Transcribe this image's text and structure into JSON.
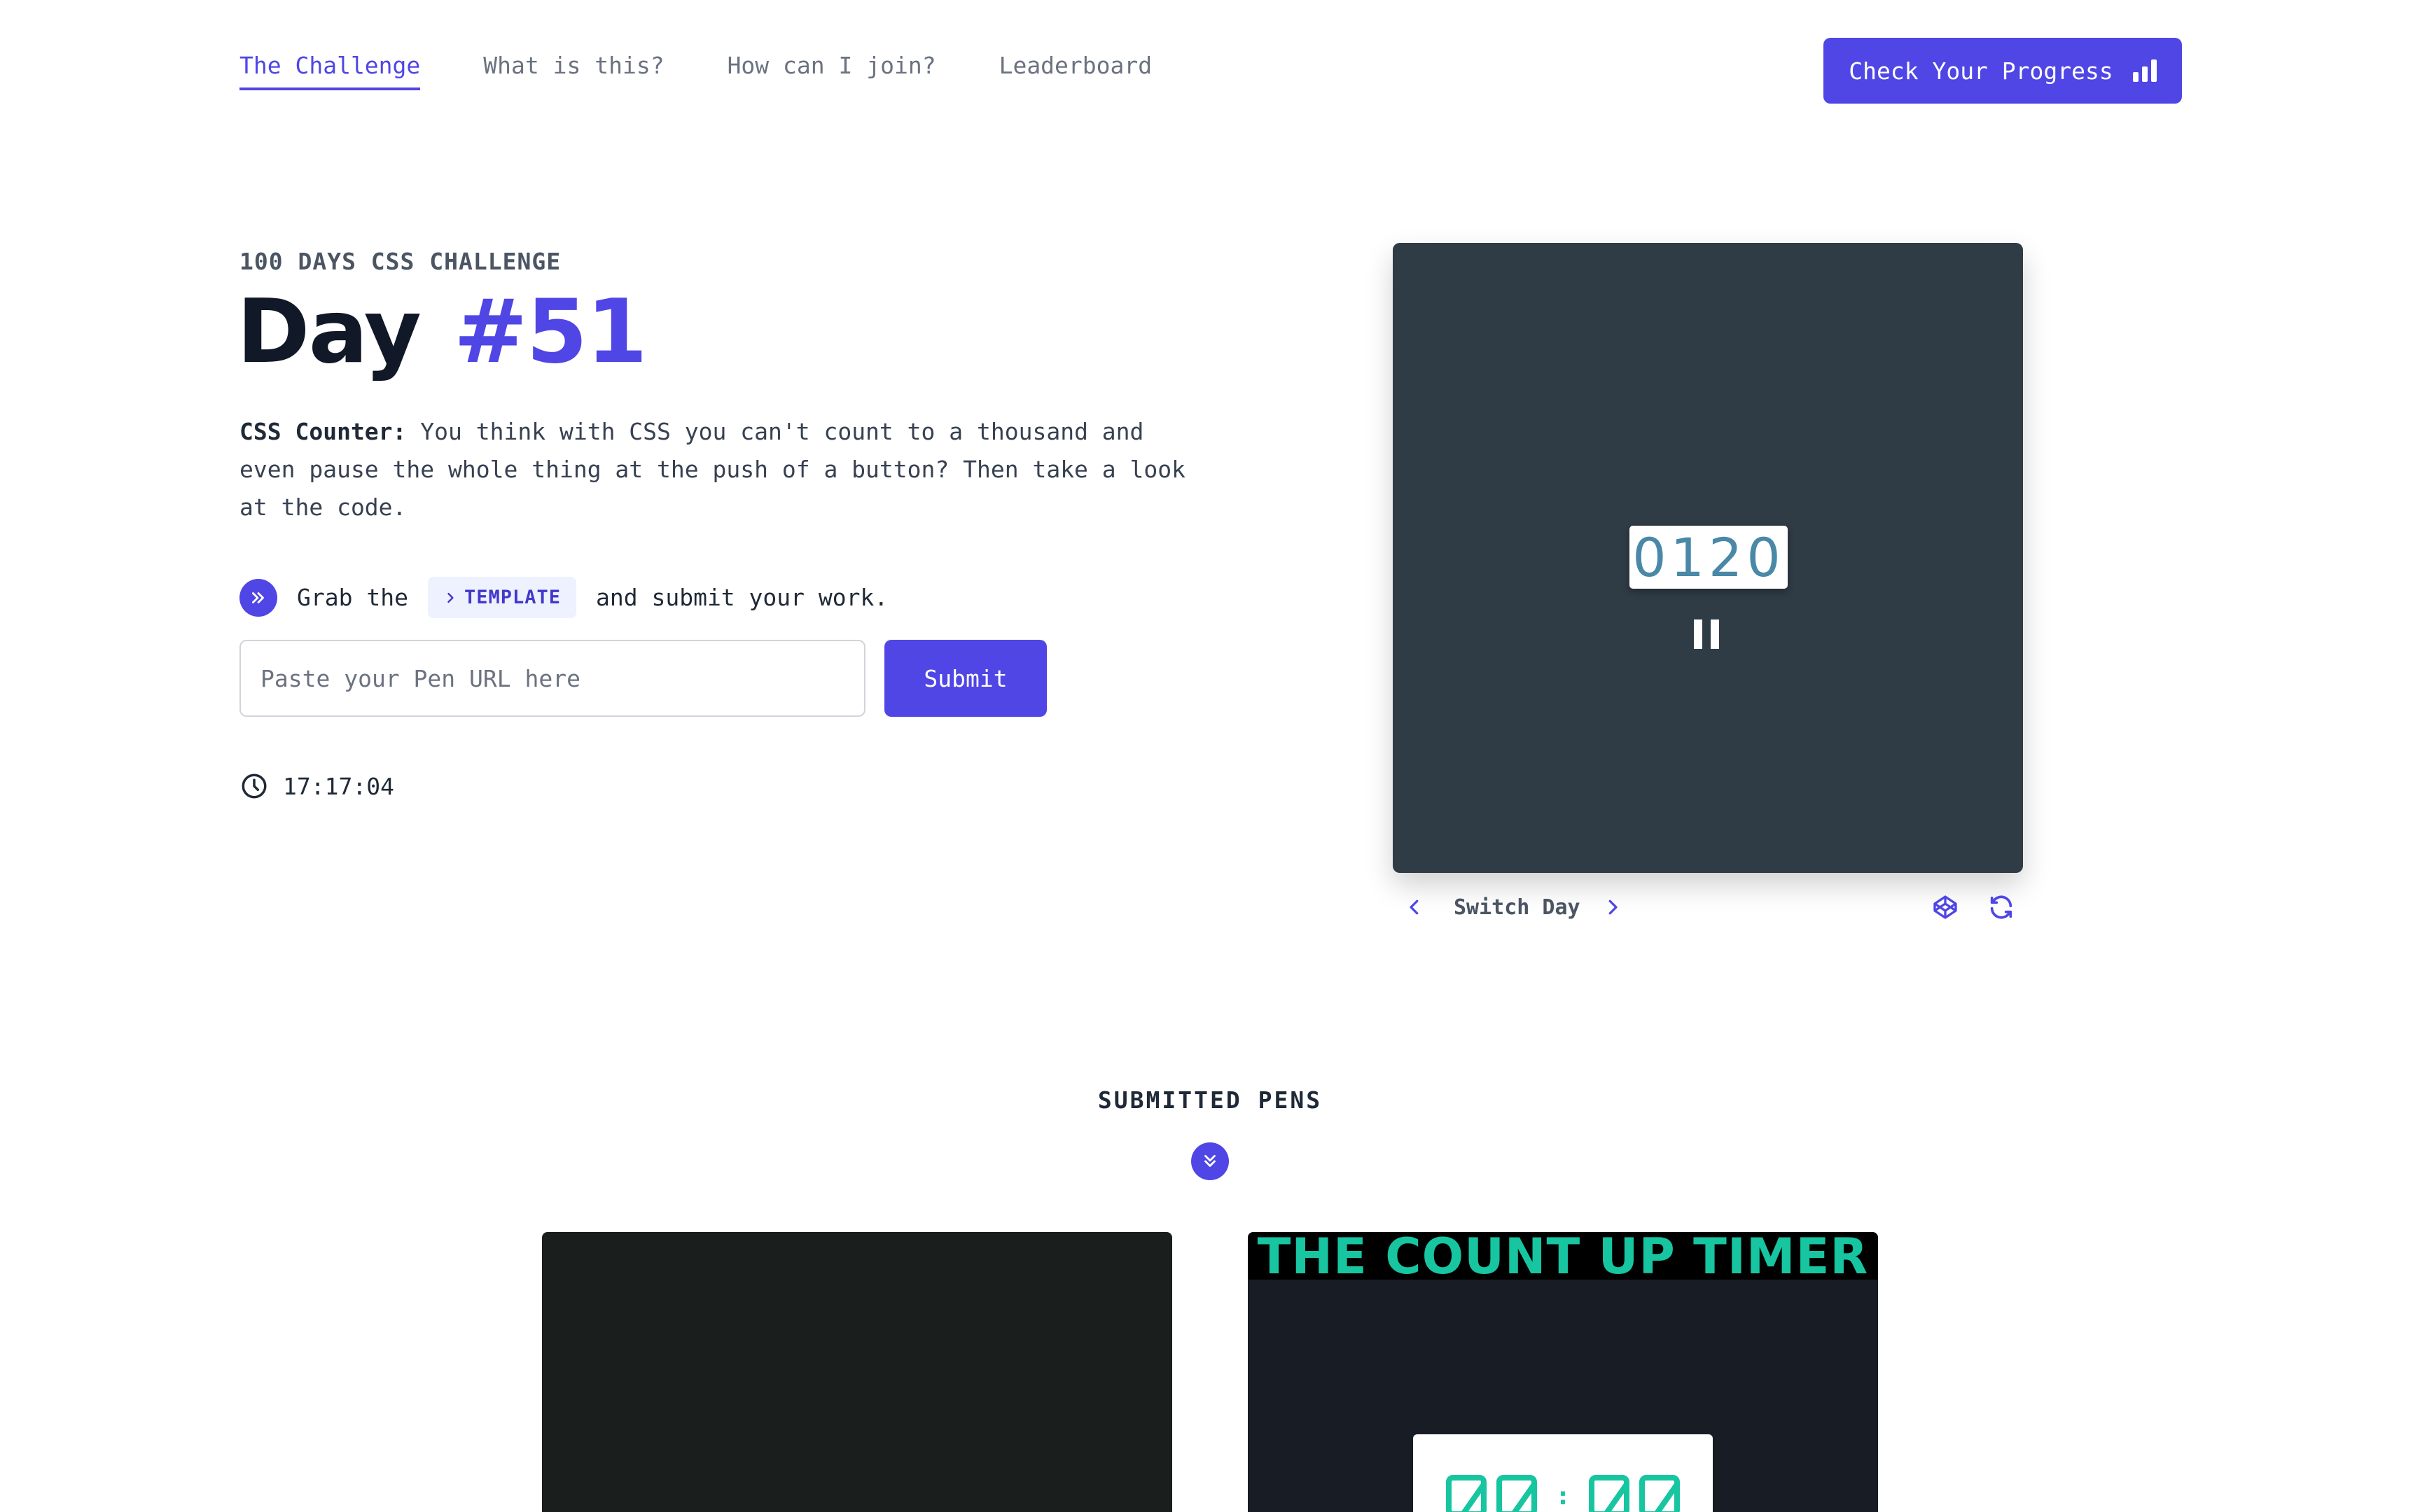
{
  "nav": {
    "links": [
      "The Challenge",
      "What is this?",
      "How can I join?",
      "Leaderboard"
    ],
    "active": 0,
    "progress_button": "Check Your Progress"
  },
  "hero": {
    "eyebrow": "100 DAYS CSS CHALLENGE",
    "title_day": "Day",
    "title_num": "#51",
    "desc_strong": "CSS Counter:",
    "desc_text": " You think with CSS you can't count to a thousand and even pause the whole thing at the push of a button? Then take a look at the code.",
    "grab_prefix": "Grab the",
    "template_label": "TEMPLATE",
    "grab_suffix": "and submit your work.",
    "url_placeholder": "Paste your Pen URL here",
    "submit_label": "Submit",
    "timer": "17:17:04"
  },
  "preview": {
    "counter": "0120",
    "switch_label": "Switch Day"
  },
  "submitted": {
    "title": "SUBMITTED PENS",
    "card_b_banner": "THE COUNT UP TIMER",
    "card_b_colon": ":"
  },
  "colors": {
    "accent": "#4f46e5",
    "preview_bg": "#2f3b45",
    "counter_text": "#4a88a8",
    "timer_green": "#17c5a1"
  },
  "icons": {
    "progress": "bar-chart-icon",
    "grab": "double-chevron-right-icon",
    "template": "chevron-right-icon",
    "timer": "clock-icon",
    "prev": "chevron-left-icon",
    "next": "chevron-right-icon",
    "codepen": "codepen-icon",
    "refresh": "refresh-icon",
    "submitted": "double-chevron-down-icon"
  }
}
